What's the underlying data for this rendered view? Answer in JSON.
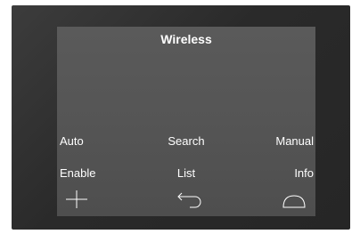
{
  "screen": {
    "title": "Wireless"
  },
  "softkeys_row1": {
    "left_label": "Auto",
    "center_label": "Search",
    "right_label": "Manual"
  },
  "softkeys_row2": {
    "left_label": "Enable",
    "center_label": "List",
    "right_label": "Info"
  },
  "icons": {
    "left": "plus-icon",
    "center": "back-arrow-icon",
    "right": "home-arch-icon"
  },
  "colors": {
    "screen_bg": "#555555",
    "bezel_bg": "#2a2a2a",
    "text": "#ffffff"
  }
}
